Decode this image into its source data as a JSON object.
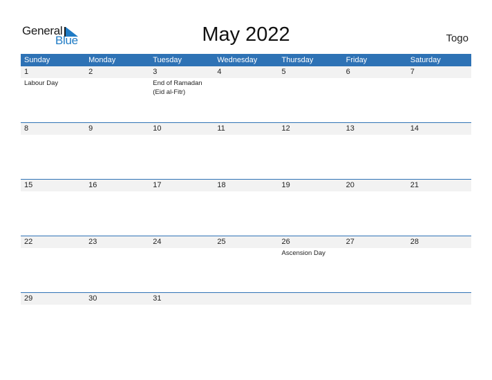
{
  "brand": {
    "word1": "General",
    "word2": "Blue"
  },
  "title": "May 2022",
  "country": "Togo",
  "colors": {
    "accent": "#2e72b5",
    "day_strip": "#f2f2f2",
    "logo_blue": "#1f7bc5"
  },
  "weekdays": [
    "Sunday",
    "Monday",
    "Tuesday",
    "Wednesday",
    "Thursday",
    "Friday",
    "Saturday"
  ],
  "weeks": [
    {
      "days": [
        "1",
        "2",
        "3",
        "4",
        "5",
        "6",
        "7"
      ],
      "events": [
        "Labour Day",
        "",
        "End of Ramadan (Eid al-Fitr)",
        "",
        "",
        "",
        ""
      ]
    },
    {
      "days": [
        "8",
        "9",
        "10",
        "11",
        "12",
        "13",
        "14"
      ],
      "events": [
        "",
        "",
        "",
        "",
        "",
        "",
        ""
      ]
    },
    {
      "days": [
        "15",
        "16",
        "17",
        "18",
        "19",
        "20",
        "21"
      ],
      "events": [
        "",
        "",
        "",
        "",
        "",
        "",
        ""
      ]
    },
    {
      "days": [
        "22",
        "23",
        "24",
        "25",
        "26",
        "27",
        "28"
      ],
      "events": [
        "",
        "",
        "",
        "",
        "Ascension Day",
        "",
        ""
      ]
    },
    {
      "days": [
        "29",
        "30",
        "31",
        "",
        "",
        "",
        ""
      ],
      "events": [
        "",
        "",
        "",
        "",
        "",
        "",
        ""
      ]
    }
  ]
}
